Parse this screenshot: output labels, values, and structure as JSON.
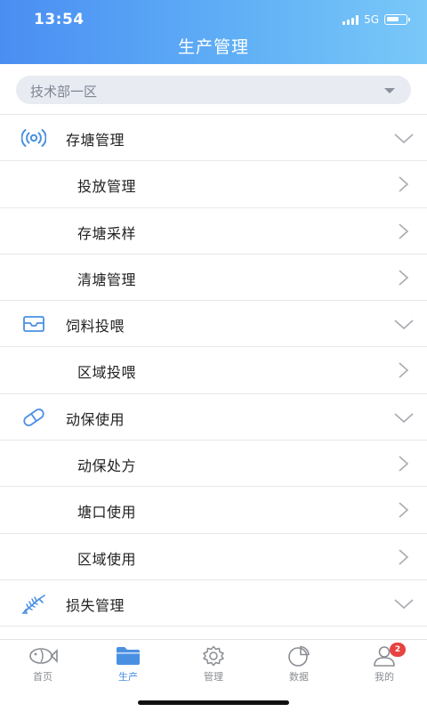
{
  "status_bar": {
    "time": "13:54",
    "network": "5G"
  },
  "header": {
    "title": "生产管理"
  },
  "area_selector": {
    "value": "技术部一区"
  },
  "sections": [
    {
      "label": "存塘管理",
      "icon": "signal-waves-icon",
      "items": [
        "投放管理",
        "存塘采样",
        "清塘管理"
      ]
    },
    {
      "label": "饲料投喂",
      "icon": "inbox-tray-icon",
      "items": [
        "区域投喂"
      ]
    },
    {
      "label": "动保使用",
      "icon": "pill-capsule-icon",
      "items": [
        "动保处方",
        "塘口使用",
        "区域使用"
      ]
    },
    {
      "label": "损失管理",
      "icon": "fish-bone-icon",
      "items": []
    }
  ],
  "tabbar": {
    "tabs": [
      {
        "label": "首页",
        "icon": "fish-icon"
      },
      {
        "label": "生产",
        "icon": "folder-icon"
      },
      {
        "label": "管理",
        "icon": "gear-icon"
      },
      {
        "label": "数据",
        "icon": "pie-chart-icon"
      },
      {
        "label": "我的",
        "icon": "user-icon",
        "badge": "2"
      }
    ],
    "active": "生产"
  },
  "colors": {
    "accent": "#4a90e2",
    "badge": "#e64340",
    "header_start": "#4a8ef2",
    "header_end": "#7ac8f8"
  }
}
